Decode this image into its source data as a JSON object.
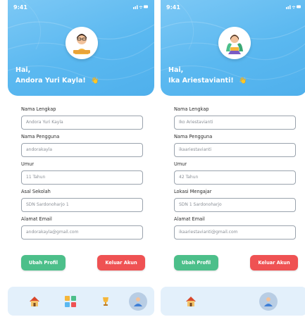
{
  "status": {
    "time": "9:41",
    "icons": "signal-wifi-battery"
  },
  "colors": {
    "header_blue": "#5ab8f0",
    "edit_green": "#4cbf8a",
    "logout_red": "#ef5253",
    "nav_bg": "#e3f0fb"
  },
  "screens": [
    {
      "greeting": "Hai,",
      "name": "Andora Yuri Kayla!",
      "fields": [
        {
          "label": "Nama Lengkap",
          "value": "Andora Yuri Kayla"
        },
        {
          "label": "Nama Pengguna",
          "value": "andorakayla"
        },
        {
          "label": "Umur",
          "value": "11 Tahun"
        },
        {
          "label": "Asal Sekolah",
          "value": "SDN Sardonoharjo 1"
        },
        {
          "label": "Alamat Email",
          "value": "andorakayla@gmail.com"
        }
      ],
      "edit_button": "Ubah Profil",
      "logout_button": "Keluar Akun",
      "nav": [
        "home-icon",
        "blocks-icon",
        "trophy-icon",
        "profile-icon"
      ]
    },
    {
      "greeting": "Hai,",
      "name": "Ika Ariestavianti!",
      "fields": [
        {
          "label": "Nama Lengkap",
          "value": "Iko Ariestavianti"
        },
        {
          "label": "Nama Pengguna",
          "value": "ikaariestavianti"
        },
        {
          "label": "Umur",
          "value": "42 Tahun"
        },
        {
          "label": "Lokasi Mengajar",
          "value": "SDN 1 Sardonoharjo"
        },
        {
          "label": "Alamat Email",
          "value": "ikaariestavianti@gmail.com"
        }
      ],
      "edit_button": "Ubah Profil",
      "logout_button": "Keluar Akun",
      "nav": [
        "home-icon",
        "profile-icon"
      ]
    }
  ]
}
